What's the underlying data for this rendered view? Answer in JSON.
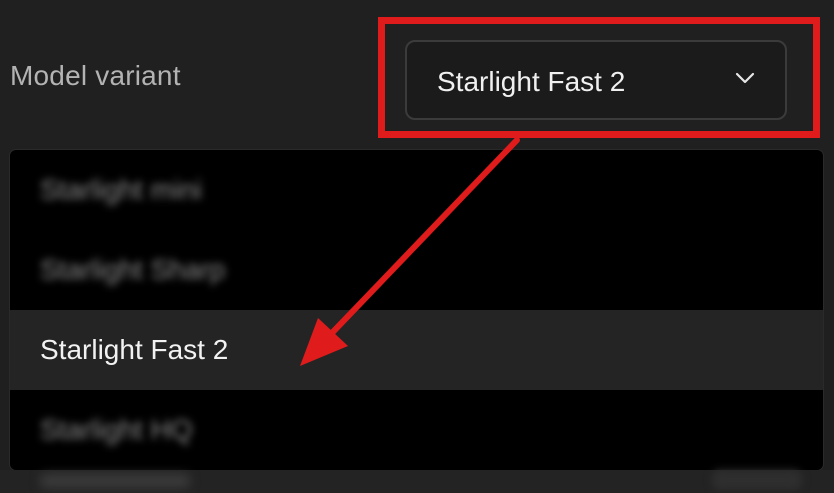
{
  "setting": {
    "label": "Model variant",
    "selected_value": "Starlight Fast 2"
  },
  "dropdown": {
    "options": [
      {
        "label": "Starlight mini",
        "blurred": true
      },
      {
        "label": "Starlight Sharp",
        "blurred": true
      },
      {
        "label": "Starlight Fast 2",
        "blurred": false,
        "selected": true
      },
      {
        "label": "Starlight HQ",
        "blurred": true
      }
    ]
  },
  "icons": {
    "select_toggle": "chevron-down-icon"
  },
  "colors": {
    "annotation": "#e01b1b",
    "background": "#202020",
    "dropdown_bg": "#000000",
    "selected_row": "#242424"
  }
}
